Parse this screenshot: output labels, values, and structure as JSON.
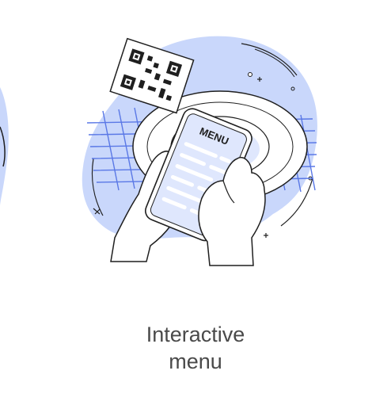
{
  "illustration": {
    "menu_word": "MENU",
    "accent_color": "#c9d7fb",
    "grid_color": "#5a78e6",
    "line_color": "#1f1f1f"
  },
  "caption": {
    "line1": "Interactive",
    "line2": "menu"
  }
}
